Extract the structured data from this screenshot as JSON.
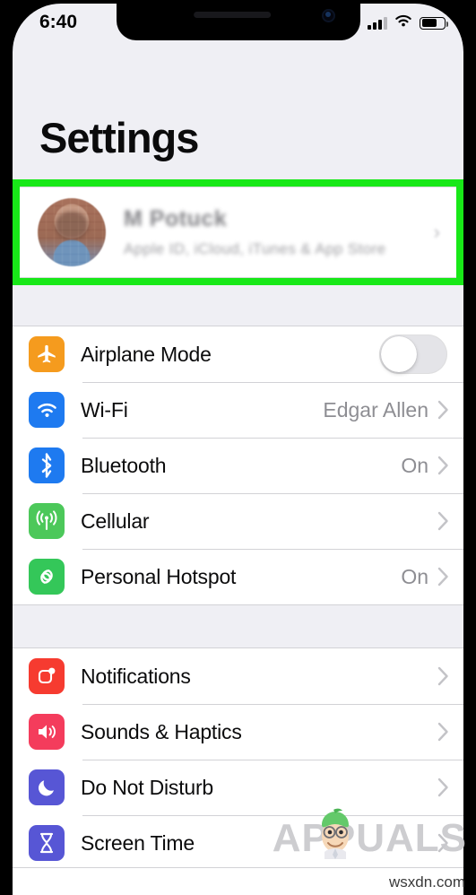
{
  "status_bar": {
    "time": "6:40",
    "cellular_icon": "signal-bars-icon",
    "cellular_bars_filled": 3,
    "cellular_bars_total": 4,
    "wifi_icon": "wifi-icon",
    "battery_icon": "battery-icon",
    "battery_percent": 60
  },
  "device": {
    "notch_icons": [
      "speaker-grille",
      "front-camera"
    ]
  },
  "header": {
    "title": "Settings"
  },
  "account": {
    "name": "M Potuck",
    "subtitle": "Apple ID, iCloud, iTunes & App Store",
    "chevron": "›",
    "avatar_icon": "user-avatar",
    "highlighted": true,
    "highlight_color": "#18e818",
    "blurred": true
  },
  "groups": [
    {
      "id": "connectivity",
      "rows": [
        {
          "label": "Airplane Mode",
          "icon": "airplane-icon",
          "icon_color": "#F59B1E",
          "control": "toggle",
          "toggle_on": false,
          "value": "",
          "chevron": false
        },
        {
          "label": "Wi-Fi",
          "icon": "wifi-icon",
          "icon_color": "#1E7AF0",
          "control": "disclosure",
          "value": "Edgar Allen",
          "chevron": true
        },
        {
          "label": "Bluetooth",
          "icon": "bluetooth-icon",
          "icon_color": "#1E7AF0",
          "control": "disclosure",
          "value": "On",
          "chevron": true
        },
        {
          "label": "Cellular",
          "icon": "cellular-antenna-icon",
          "icon_color": "#4CC85A",
          "control": "disclosure",
          "value": "",
          "chevron": true
        },
        {
          "label": "Personal Hotspot",
          "icon": "hotspot-link-icon",
          "icon_color": "#34C759",
          "control": "disclosure",
          "value": "On",
          "chevron": true
        }
      ]
    },
    {
      "id": "alerts",
      "rows": [
        {
          "label": "Notifications",
          "icon": "notifications-badge-icon",
          "icon_color": "#F63B30",
          "control": "disclosure",
          "value": "",
          "chevron": true
        },
        {
          "label": "Sounds & Haptics",
          "icon": "speaker-waves-icon",
          "icon_color": "#F43C5C",
          "control": "disclosure",
          "value": "",
          "chevron": true
        },
        {
          "label": "Do Not Disturb",
          "icon": "moon-icon",
          "icon_color": "#5756D5",
          "control": "disclosure",
          "value": "",
          "chevron": true
        },
        {
          "label": "Screen Time",
          "icon": "hourglass-icon",
          "icon_color": "#5756D5",
          "control": "disclosure",
          "value": "",
          "chevron": true
        }
      ]
    }
  ],
  "watermark": {
    "text": "APPUALS",
    "mascot_icon": "appuals-mascot-icon"
  },
  "footer": {
    "url": "wsxdn.com"
  }
}
